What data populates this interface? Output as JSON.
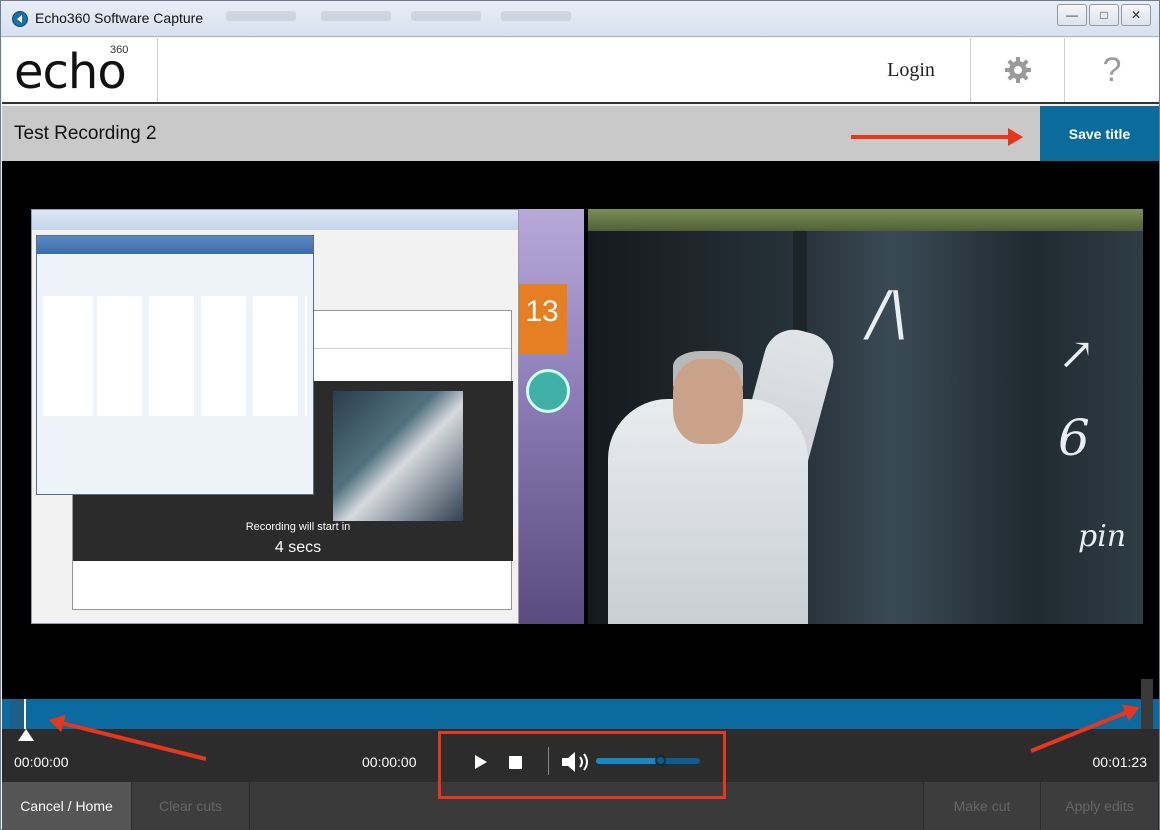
{
  "window": {
    "title": "Echo360 Software Capture",
    "controls": [
      "minimize",
      "maximize",
      "close"
    ]
  },
  "header": {
    "logo_text": "echo",
    "logo_sup": "360",
    "login_label": "Login",
    "settings_icon": "gear-icon",
    "help_label": "?"
  },
  "recording": {
    "title": "Test Recording 2",
    "save_title_label": "Save title"
  },
  "preview": {
    "screen_calendar_day": "13",
    "screen_count_text": "Recording will start in",
    "screen_count_value": "4 secs"
  },
  "player": {
    "time_start": "00:00:00",
    "time_current": "00:00:00",
    "time_end": "00:01:23",
    "volume_level_percent": 62
  },
  "actions": {
    "cancel_home": "Cancel / Home",
    "clear_cuts": "Clear cuts",
    "make_cut": "Make cut",
    "apply_edits": "Apply edits"
  },
  "colors": {
    "accent": "#0b6b9a",
    "annotation": "#e8361d"
  }
}
